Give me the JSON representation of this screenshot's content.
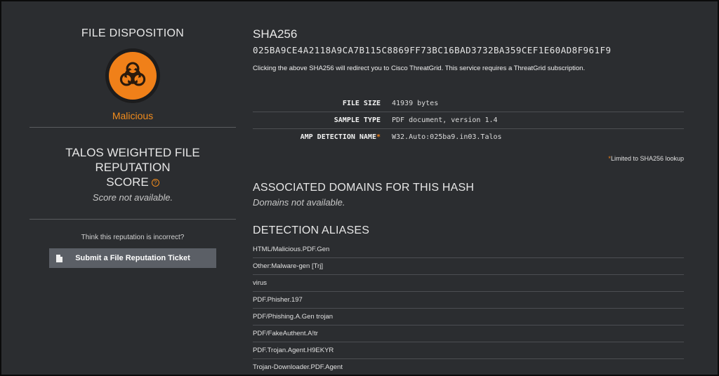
{
  "disposition": {
    "title": "FILE DISPOSITION",
    "icon": "biohazard-icon",
    "verdict": "Malicious",
    "verdict_color": "#f28c1c"
  },
  "reputation": {
    "title_line1": "TALOS WEIGHTED FILE REPUTATION",
    "title_line2": "SCORE",
    "help_glyph": "?",
    "score_text": "Score not available.",
    "incorrect_prompt": "Think this reputation is incorrect?",
    "ticket_button": "Submit a File Reputation Ticket"
  },
  "sha": {
    "title": "SHA256",
    "hash": "025BA9CE4A2118A9CA7B115C8869FF73BC16BAD3732BA359CEF1E60AD8F961F9",
    "note": "Clicking the above SHA256 will redirect you to Cisco ThreatGrid. This service requires a ThreatGrid subscription."
  },
  "properties": [
    {
      "key": "FILE SIZE",
      "star": "",
      "value": "41939 bytes"
    },
    {
      "key": "SAMPLE TYPE",
      "star": "",
      "value": "PDF document, version 1.4"
    },
    {
      "key": "AMP DETECTION NAME",
      "star": "*",
      "value": "W32.Auto:025ba9.in03.Talos"
    }
  ],
  "limited_note": {
    "star": "*",
    "text": "Limited to SHA256 lookup"
  },
  "domains": {
    "title": "ASSOCIATED DOMAINS FOR THIS HASH",
    "empty_text": "Domains not available."
  },
  "aliases": {
    "title": "DETECTION ALIASES",
    "items": [
      "HTML/Malicious.PDF.Gen",
      "Other:Malware-gen [Trj]",
      "virus",
      "PDF.Phisher.197",
      "PDF/Phishing.A.Gen trojan",
      "PDF/FakeAuthent.A!tr",
      "PDF.Trojan.Agent.H9EKYR",
      "Trojan-Downloader.PDF.Agent"
    ]
  },
  "colors": {
    "background": "#2b2d30",
    "accent": "#f08019",
    "button": "#5b5f66"
  }
}
